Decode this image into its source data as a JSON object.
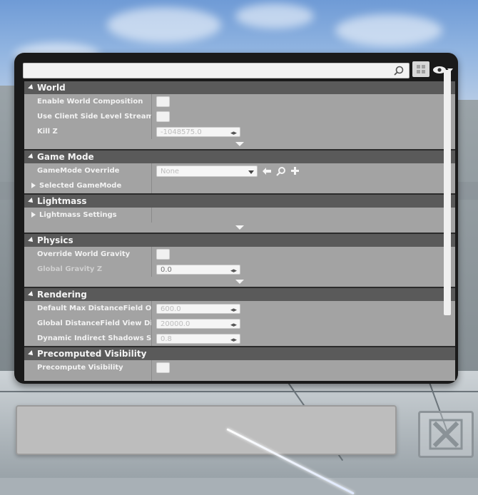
{
  "search": {
    "value": "",
    "placeholder": ""
  },
  "sections": {
    "world": {
      "title": "World",
      "enable_world_composition": "Enable World Composition",
      "use_client_side_level_streaming": "Use Client Side Level Streaming Volumes",
      "kill_z_label": "Kill Z",
      "kill_z_value": "-1048575.0"
    },
    "game_mode": {
      "title": "Game Mode",
      "gamemode_override_label": "GameMode Override",
      "gamemode_override_value": "None",
      "selected_gamemode_label": "Selected GameMode"
    },
    "lightmass": {
      "title": "Lightmass",
      "lightmass_settings_label": "Lightmass Settings"
    },
    "physics": {
      "title": "Physics",
      "override_world_gravity_label": "Override World Gravity",
      "global_gravity_z_label": "Global Gravity Z",
      "global_gravity_z_value": "0.0"
    },
    "rendering": {
      "title": "Rendering",
      "default_max_df_label": "Default Max DistanceField Occlusion Distance",
      "default_max_df_value": "600.0",
      "global_df_view_label": "Global DistanceField View Distance",
      "global_df_view_value": "20000.0",
      "dynamic_indirect_label": "Dynamic Indirect Shadows Self Shadowing Intensity",
      "dynamic_indirect_value": "0.8"
    },
    "precomputed_visibility": {
      "title": "Precomputed Visibility",
      "precompute_visibility_label": "Precompute Visibility"
    }
  },
  "spinner_glyph": "◂▸",
  "icons": [
    "search-icon",
    "grid-view-icon",
    "eye-icon",
    "use-selected-arrow-icon",
    "browse-icon",
    "add-icon",
    "close-icon"
  ]
}
